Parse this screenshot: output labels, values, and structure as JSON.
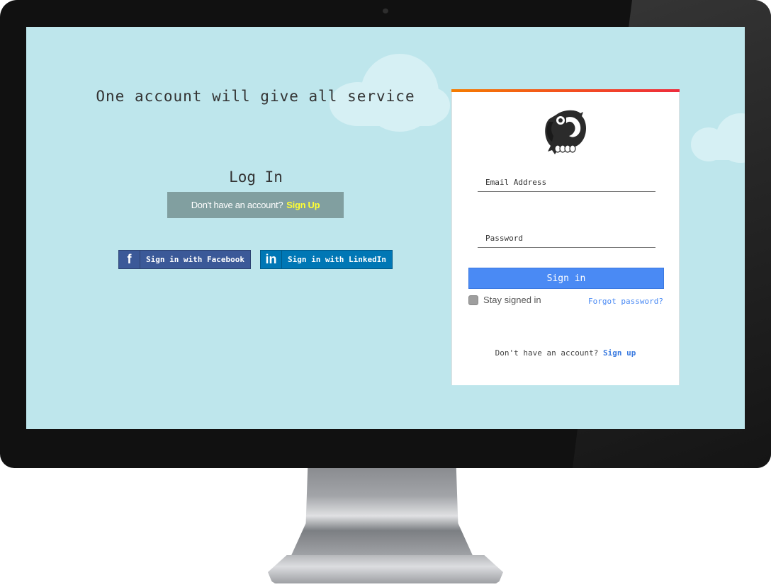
{
  "device": {
    "type": "desktop-monitor-mockup"
  },
  "hero": {
    "tagline": "One account will give all service",
    "login_title": "Log In",
    "signup_banner": {
      "prompt": "Don't have an account?",
      "link": "Sign Up"
    },
    "social": {
      "facebook": {
        "icon": "facebook-icon",
        "glyph": "f",
        "label": "Sign in with Facebook"
      },
      "linkedin": {
        "icon": "linkedin-icon",
        "glyph": "in",
        "label": "Sign in with LinkedIn"
      }
    }
  },
  "card": {
    "logo": "parrot-logo",
    "email_placeholder": "Email Address",
    "password_placeholder": "Password",
    "signin_label": "Sign in",
    "stay_signed_in": {
      "label": "Stay signed in",
      "checked": false
    },
    "forgot_password": "Forgot password?",
    "footer": {
      "prompt": "Don't have an account?",
      "link": "Sign up"
    }
  },
  "colors": {
    "screen_bg": "#bee6ec",
    "facebook": "#3b5998",
    "linkedin": "#0077b5",
    "primary": "#4a8af4",
    "banner_bg": "#819fa0",
    "banner_link": "#ffff33",
    "topbar_start": "#f57c00",
    "topbar_end": "#ee2c3c"
  }
}
